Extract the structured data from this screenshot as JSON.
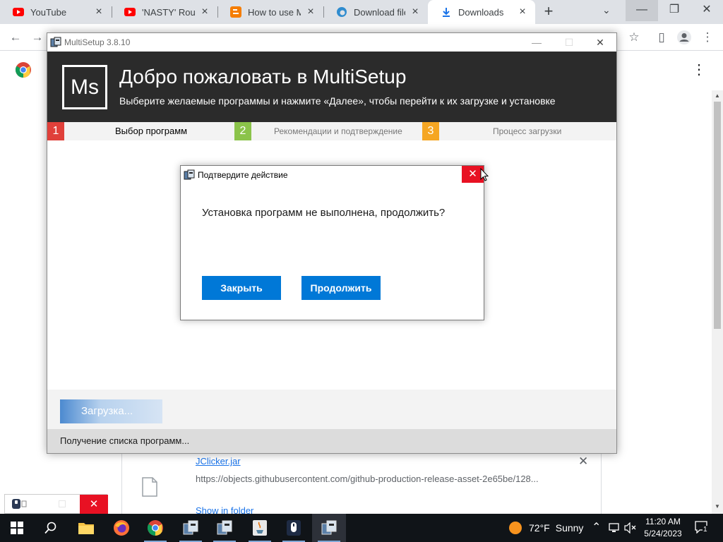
{
  "browser": {
    "tabs": [
      {
        "title": "YouTube",
        "icon": "youtube-icon"
      },
      {
        "title": "'NASTY' Route F",
        "icon": "youtube-icon"
      },
      {
        "title": "How to use Ma",
        "icon": "blogger-icon"
      },
      {
        "title": "Download file C",
        "icon": "edge-icon"
      },
      {
        "title": "Downloads",
        "icon": "download-icon"
      }
    ],
    "new_tab": "+",
    "tab_search": "⌄",
    "window_controls": {
      "minimize": "—",
      "restore": "❐",
      "close": "✕"
    },
    "toolbar": {
      "back": "←",
      "forward": "→",
      "star": "☆",
      "sidebar": "▯",
      "menu": "⋮"
    }
  },
  "downloads_page": {
    "menu": "⋮",
    "item": {
      "filename": "JClicker.jar",
      "url": "https://objects.githubusercontent.com/github-production-release-asset-2e65be/128...",
      "show_in_folder": "Show in folder",
      "remove": "✕"
    }
  },
  "multisetup": {
    "title": "MultiSetup 3.8.10",
    "logo": "Ms",
    "heading": "Добро пожаловать в MultiSetup",
    "subheading": "Выберите желаемые программы и нажмите «Далее», чтобы перейти к их загрузке и установке",
    "steps": [
      {
        "num": "1",
        "label": "Выбор программ",
        "color": "#e0403a"
      },
      {
        "num": "2",
        "label": "Рекомендации и подтверждение",
        "color": "#8bc34a"
      },
      {
        "num": "3",
        "label": "Процесс загрузки",
        "color": "#f5a623"
      }
    ],
    "loading_button": "Загрузка...",
    "status": "Получение списка программ...",
    "window_controls": {
      "minimize": "—",
      "maximize": "☐",
      "close": "✕"
    }
  },
  "dialog": {
    "title": "Подтвердите действие",
    "message": "Установка программ не выполнена, продолжить?",
    "close_button": "Закрыть",
    "continue_button": "Продолжить",
    "close_icon": "✕"
  },
  "widget": {
    "close": "✕"
  },
  "taskbar": {
    "weather": {
      "temp": "72°F",
      "condition": "Sunny"
    },
    "clock": {
      "time": "11:20 AM",
      "date": "5/24/2023"
    },
    "notifications_count": "1"
  }
}
